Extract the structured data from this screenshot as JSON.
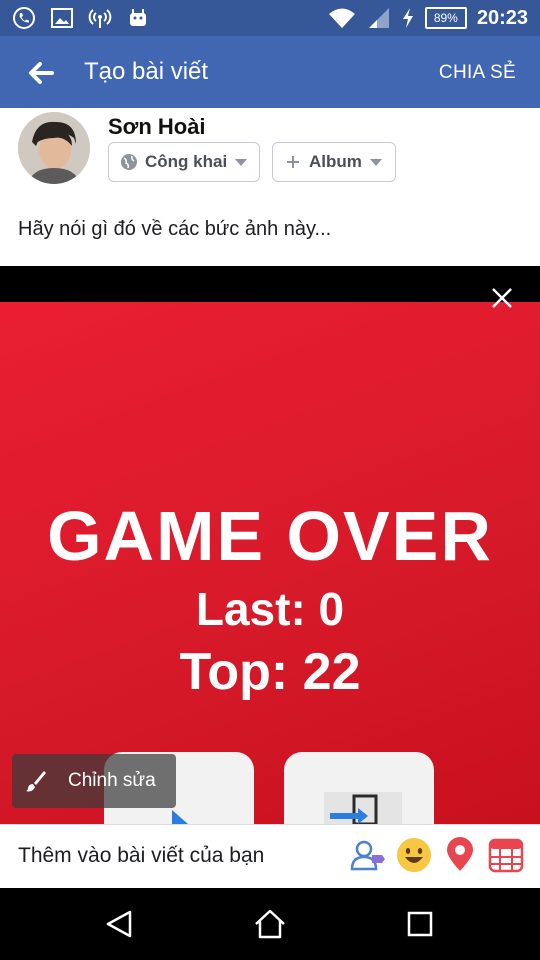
{
  "status_bar": {
    "time": "20:23",
    "battery": "89%",
    "icons": [
      "phone-icon",
      "image-icon",
      "hotspot-icon",
      "android-icon",
      "wifi-icon",
      "signal-icon",
      "charging-icon",
      "battery-icon"
    ]
  },
  "app_bar": {
    "title": "Tạo bài viết",
    "share_label": "CHIA SẺ"
  },
  "composer": {
    "user_name": "Sơn Hoài",
    "privacy_label": "Công khai",
    "album_label": "Album",
    "prompt_text": "Hãy nói gì đó về các bức ảnh này..."
  },
  "photo": {
    "game_over_title": "GAME OVER",
    "last_score_text": "Last: 0",
    "top_score_text": "Top: 22",
    "edit_label": "Chỉnh sửa",
    "background_color": "#dc1c2e"
  },
  "add_to_post": {
    "label": "Thêm vào bài viết của bạn",
    "icons": [
      "tag-people-icon",
      "feeling-emoji-icon",
      "location-pin-icon",
      "event-calendar-icon"
    ]
  },
  "nav_bar": {
    "buttons": [
      "back-triangle-icon",
      "home-icon",
      "recents-icon"
    ]
  },
  "colors": {
    "facebook_blue": "#4267b2",
    "status_bar_blue": "#365899"
  }
}
